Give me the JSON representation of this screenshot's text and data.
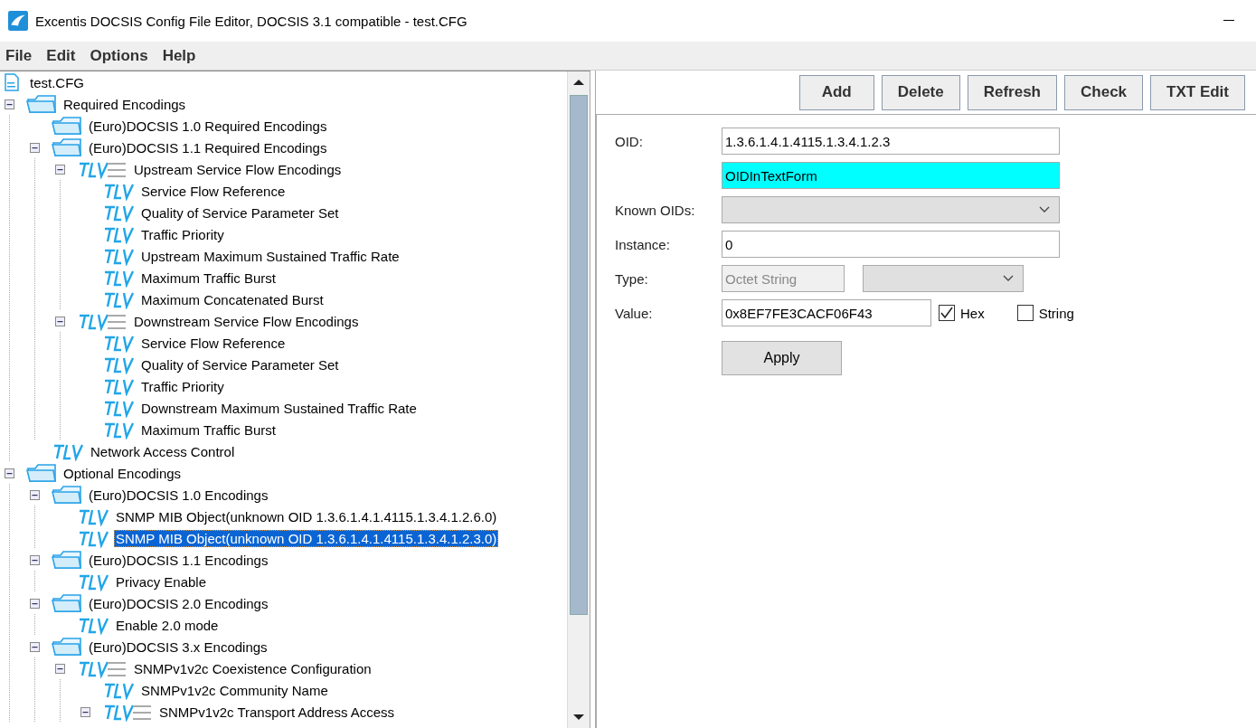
{
  "window": {
    "title": "Excentis DOCSIS Config File Editor, DOCSIS 3.1 compatible - test.CFG"
  },
  "menu": [
    "File",
    "Edit",
    "Options",
    "Help"
  ],
  "tree": {
    "label": "test.CFG",
    "kind": "file",
    "selected": false,
    "children": [
      {
        "label": "Required Encodings",
        "kind": "folder",
        "expanded": true,
        "selected": false,
        "children": [
          {
            "label": "(Euro)DOCSIS 1.0 Required Encodings",
            "kind": "folder",
            "selected": false
          },
          {
            "label": "(Euro)DOCSIS 1.1 Required Encodings",
            "kind": "folder",
            "expanded": true,
            "selected": false,
            "children": [
              {
                "label": "Upstream Service Flow Encodings",
                "kind": "group",
                "expanded": true,
                "selected": false,
                "children": [
                  {
                    "label": "Service Flow Reference",
                    "kind": "tlv",
                    "selected": false
                  },
                  {
                    "label": "Quality of Service Parameter Set",
                    "kind": "tlv",
                    "selected": false
                  },
                  {
                    "label": "Traffic Priority",
                    "kind": "tlv",
                    "selected": false
                  },
                  {
                    "label": "Upstream Maximum Sustained Traffic Rate",
                    "kind": "tlv",
                    "selected": false
                  },
                  {
                    "label": "Maximum Traffic Burst",
                    "kind": "tlv",
                    "selected": false
                  },
                  {
                    "label": "Maximum Concatenated Burst",
                    "kind": "tlv",
                    "selected": false
                  }
                ]
              },
              {
                "label": "Downstream Service Flow Encodings",
                "kind": "group",
                "expanded": true,
                "selected": false,
                "children": [
                  {
                    "label": "Service Flow Reference",
                    "kind": "tlv",
                    "selected": false
                  },
                  {
                    "label": "Quality of Service Parameter Set",
                    "kind": "tlv",
                    "selected": false
                  },
                  {
                    "label": "Traffic Priority",
                    "kind": "tlv",
                    "selected": false
                  },
                  {
                    "label": "Downstream Maximum Sustained Traffic Rate",
                    "kind": "tlv",
                    "selected": false
                  },
                  {
                    "label": "Maximum Traffic Burst",
                    "kind": "tlv",
                    "selected": false
                  }
                ]
              }
            ]
          },
          {
            "label": "Network Access Control",
            "kind": "tlv",
            "selected": false
          }
        ]
      },
      {
        "label": "Optional Encodings",
        "kind": "folder",
        "expanded": true,
        "selected": false,
        "children": [
          {
            "label": "(Euro)DOCSIS 1.0 Encodings",
            "kind": "folder",
            "expanded": true,
            "selected": false,
            "children": [
              {
                "label": "SNMP MIB Object(unknown OID 1.3.6.1.4.1.4115.1.3.4.1.2.6.0)",
                "kind": "tlv",
                "selected": false
              },
              {
                "label": "SNMP MIB Object(unknown OID 1.3.6.1.4.1.4115.1.3.4.1.2.3.0)",
                "kind": "tlv",
                "selected": true
              }
            ]
          },
          {
            "label": "(Euro)DOCSIS 1.1 Encodings",
            "kind": "folder",
            "expanded": true,
            "selected": false,
            "children": [
              {
                "label": "Privacy Enable",
                "kind": "tlv",
                "selected": false
              }
            ]
          },
          {
            "label": "(Euro)DOCSIS 2.0 Encodings",
            "kind": "folder",
            "expanded": true,
            "selected": false,
            "children": [
              {
                "label": "Enable 2.0 mode",
                "kind": "tlv",
                "selected": false
              }
            ]
          },
          {
            "label": "(Euro)DOCSIS 3.x Encodings",
            "kind": "folder",
            "expanded": true,
            "selected": false,
            "children": [
              {
                "label": "SNMPv1v2c Coexistence Configuration",
                "kind": "group",
                "expanded": true,
                "selected": false,
                "children": [
                  {
                    "label": "SNMPv1v2c Community Name",
                    "kind": "tlv",
                    "selected": false
                  },
                  {
                    "label": "SNMPv1v2c Transport Address Access",
                    "kind": "group",
                    "expanded": true,
                    "selected": false
                  }
                ]
              }
            ]
          }
        ]
      }
    ]
  },
  "toolbar": [
    "Add",
    "Delete",
    "Refresh",
    "Check",
    "TXT Edit"
  ],
  "form": {
    "oid": {
      "label": "OID:",
      "value": "1.3.6.1.4.1.4115.1.3.4.1.2.3"
    },
    "oid_text": {
      "value": "OIDInTextForm"
    },
    "known_oids": {
      "label": "Known OIDs:"
    },
    "instance": {
      "label": "Instance:",
      "value": "0"
    },
    "type": {
      "label": "Type:",
      "value": "Octet String",
      "disabled": true
    },
    "value": {
      "label": "Value:",
      "value": "0x8EF7FE3CACF06F43"
    },
    "formats": [
      {
        "label": "Hex",
        "checked": true
      },
      {
        "label": "String",
        "checked": false
      }
    ],
    "apply": "Apply"
  }
}
